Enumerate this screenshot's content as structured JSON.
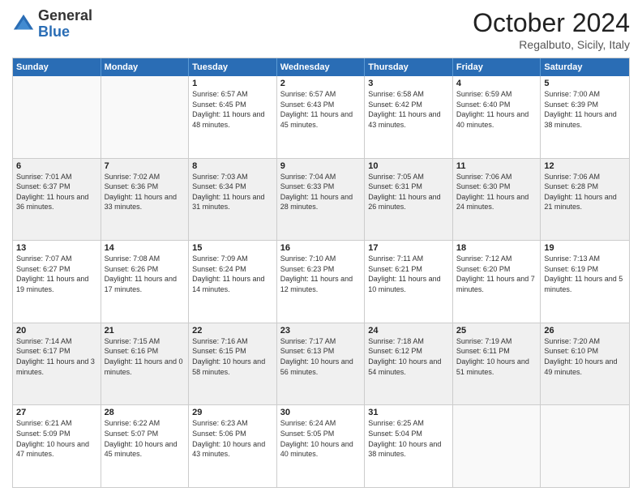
{
  "header": {
    "logo": {
      "line1": "General",
      "line2": "Blue"
    },
    "month": "October 2024",
    "location": "Regalbuto, Sicily, Italy"
  },
  "weekdays": [
    "Sunday",
    "Monday",
    "Tuesday",
    "Wednesday",
    "Thursday",
    "Friday",
    "Saturday"
  ],
  "rows": [
    [
      {
        "day": "",
        "text": ""
      },
      {
        "day": "",
        "text": ""
      },
      {
        "day": "1",
        "text": "Sunrise: 6:57 AM\nSunset: 6:45 PM\nDaylight: 11 hours and 48 minutes."
      },
      {
        "day": "2",
        "text": "Sunrise: 6:57 AM\nSunset: 6:43 PM\nDaylight: 11 hours and 45 minutes."
      },
      {
        "day": "3",
        "text": "Sunrise: 6:58 AM\nSunset: 6:42 PM\nDaylight: 11 hours and 43 minutes."
      },
      {
        "day": "4",
        "text": "Sunrise: 6:59 AM\nSunset: 6:40 PM\nDaylight: 11 hours and 40 minutes."
      },
      {
        "day": "5",
        "text": "Sunrise: 7:00 AM\nSunset: 6:39 PM\nDaylight: 11 hours and 38 minutes."
      }
    ],
    [
      {
        "day": "6",
        "text": "Sunrise: 7:01 AM\nSunset: 6:37 PM\nDaylight: 11 hours and 36 minutes."
      },
      {
        "day": "7",
        "text": "Sunrise: 7:02 AM\nSunset: 6:36 PM\nDaylight: 11 hours and 33 minutes."
      },
      {
        "day": "8",
        "text": "Sunrise: 7:03 AM\nSunset: 6:34 PM\nDaylight: 11 hours and 31 minutes."
      },
      {
        "day": "9",
        "text": "Sunrise: 7:04 AM\nSunset: 6:33 PM\nDaylight: 11 hours and 28 minutes."
      },
      {
        "day": "10",
        "text": "Sunrise: 7:05 AM\nSunset: 6:31 PM\nDaylight: 11 hours and 26 minutes."
      },
      {
        "day": "11",
        "text": "Sunrise: 7:06 AM\nSunset: 6:30 PM\nDaylight: 11 hours and 24 minutes."
      },
      {
        "day": "12",
        "text": "Sunrise: 7:06 AM\nSunset: 6:28 PM\nDaylight: 11 hours and 21 minutes."
      }
    ],
    [
      {
        "day": "13",
        "text": "Sunrise: 7:07 AM\nSunset: 6:27 PM\nDaylight: 11 hours and 19 minutes."
      },
      {
        "day": "14",
        "text": "Sunrise: 7:08 AM\nSunset: 6:26 PM\nDaylight: 11 hours and 17 minutes."
      },
      {
        "day": "15",
        "text": "Sunrise: 7:09 AM\nSunset: 6:24 PM\nDaylight: 11 hours and 14 minutes."
      },
      {
        "day": "16",
        "text": "Sunrise: 7:10 AM\nSunset: 6:23 PM\nDaylight: 11 hours and 12 minutes."
      },
      {
        "day": "17",
        "text": "Sunrise: 7:11 AM\nSunset: 6:21 PM\nDaylight: 11 hours and 10 minutes."
      },
      {
        "day": "18",
        "text": "Sunrise: 7:12 AM\nSunset: 6:20 PM\nDaylight: 11 hours and 7 minutes."
      },
      {
        "day": "19",
        "text": "Sunrise: 7:13 AM\nSunset: 6:19 PM\nDaylight: 11 hours and 5 minutes."
      }
    ],
    [
      {
        "day": "20",
        "text": "Sunrise: 7:14 AM\nSunset: 6:17 PM\nDaylight: 11 hours and 3 minutes."
      },
      {
        "day": "21",
        "text": "Sunrise: 7:15 AM\nSunset: 6:16 PM\nDaylight: 11 hours and 0 minutes."
      },
      {
        "day": "22",
        "text": "Sunrise: 7:16 AM\nSunset: 6:15 PM\nDaylight: 10 hours and 58 minutes."
      },
      {
        "day": "23",
        "text": "Sunrise: 7:17 AM\nSunset: 6:13 PM\nDaylight: 10 hours and 56 minutes."
      },
      {
        "day": "24",
        "text": "Sunrise: 7:18 AM\nSunset: 6:12 PM\nDaylight: 10 hours and 54 minutes."
      },
      {
        "day": "25",
        "text": "Sunrise: 7:19 AM\nSunset: 6:11 PM\nDaylight: 10 hours and 51 minutes."
      },
      {
        "day": "26",
        "text": "Sunrise: 7:20 AM\nSunset: 6:10 PM\nDaylight: 10 hours and 49 minutes."
      }
    ],
    [
      {
        "day": "27",
        "text": "Sunrise: 6:21 AM\nSunset: 5:09 PM\nDaylight: 10 hours and 47 minutes."
      },
      {
        "day": "28",
        "text": "Sunrise: 6:22 AM\nSunset: 5:07 PM\nDaylight: 10 hours and 45 minutes."
      },
      {
        "day": "29",
        "text": "Sunrise: 6:23 AM\nSunset: 5:06 PM\nDaylight: 10 hours and 43 minutes."
      },
      {
        "day": "30",
        "text": "Sunrise: 6:24 AM\nSunset: 5:05 PM\nDaylight: 10 hours and 40 minutes."
      },
      {
        "day": "31",
        "text": "Sunrise: 6:25 AM\nSunset: 5:04 PM\nDaylight: 10 hours and 38 minutes."
      },
      {
        "day": "",
        "text": ""
      },
      {
        "day": "",
        "text": ""
      }
    ]
  ]
}
